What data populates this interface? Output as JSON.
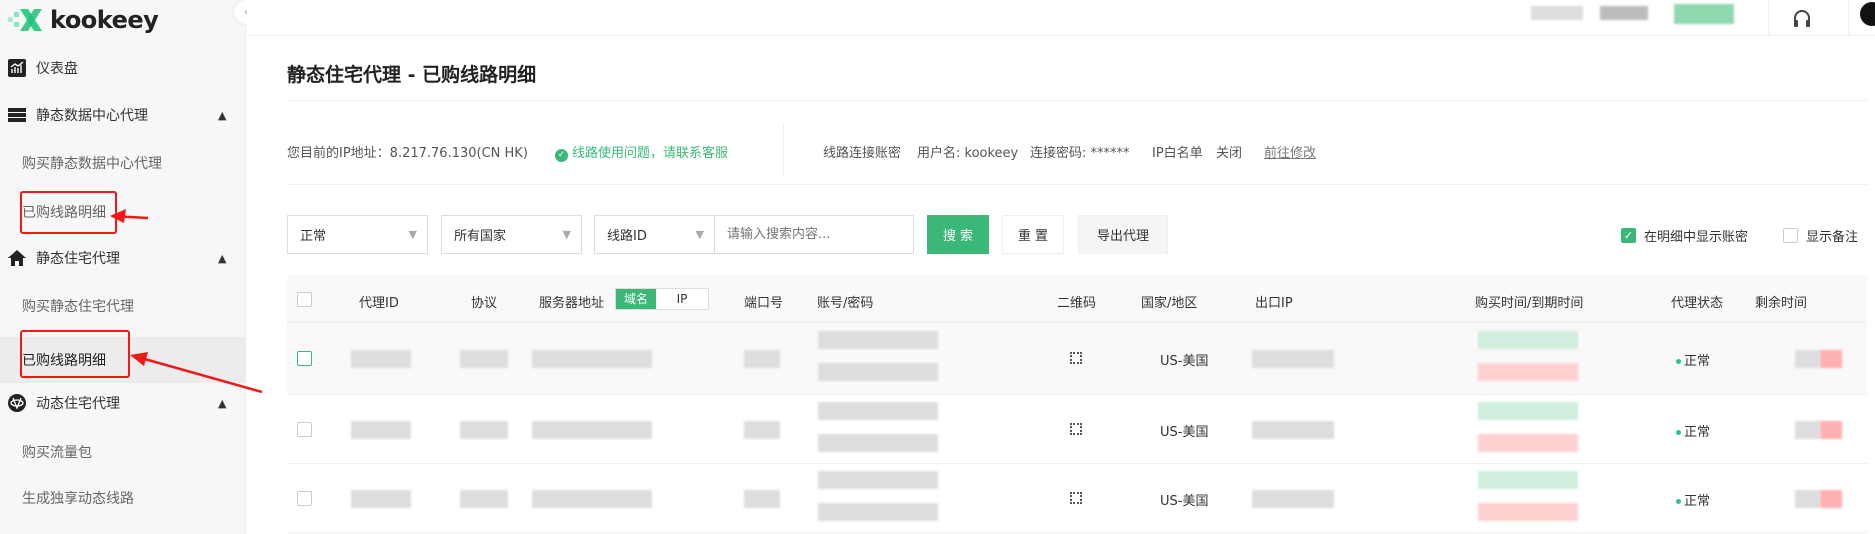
{
  "brand": {
    "name": "kookeey",
    "accent": "#3bb878"
  },
  "sidebar": {
    "items": [
      {
        "label": "仪表盘",
        "icon": "dashboard-icon"
      },
      {
        "label": "静态数据中心代理",
        "icon": "server-icon"
      },
      {
        "label": "购买静态数据中心代理"
      },
      {
        "label": "已购线路明细"
      },
      {
        "label": "静态住宅代理",
        "icon": "home-icon"
      },
      {
        "label": "购买静态住宅代理"
      },
      {
        "label": "已购线路明细"
      },
      {
        "label": "动态住宅代理",
        "icon": "globe-icon"
      },
      {
        "label": "购买流量包"
      },
      {
        "label": "生成独享动态线路"
      }
    ]
  },
  "page": {
    "title": "静态住宅代理 - 已购线路明细"
  },
  "info": {
    "ip_label": "您目前的IP地址：8.217.76.130(CN HK)",
    "support": "线路使用问题，请联系客服",
    "account_label": "线路连接账密",
    "username": "用户名: kookeey",
    "password": "连接密码: ******",
    "whitelist": "IP白名单",
    "whitelist_state": "关闭",
    "edit_link": "前往修改"
  },
  "filters": {
    "status": "正常",
    "country": "所有国家",
    "field": "线路ID",
    "search_placeholder": "请输入搜索内容...",
    "search": "搜 索",
    "reset": "重 置",
    "export": "导出代理",
    "show_account": "在明细中显示账密",
    "show_account_checked": true,
    "show_note": "显示备注",
    "show_note_checked": false
  },
  "table": {
    "headers": {
      "id": "代理ID",
      "protocol": "协议",
      "server": "服务器地址",
      "domain": "域名",
      "ip": "IP",
      "port": "端口号",
      "account": "账号/密码",
      "qr": "二维码",
      "country": "国家/地区",
      "exit_ip": "出口IP",
      "time": "购买时间/到期时间",
      "status": "代理状态",
      "remaining": "剩余时间"
    },
    "rows": [
      {
        "country": "US-美国",
        "status": "正常"
      },
      {
        "country": "US-美国",
        "status": "正常"
      },
      {
        "country": "US-美国",
        "status": "正常"
      }
    ]
  }
}
